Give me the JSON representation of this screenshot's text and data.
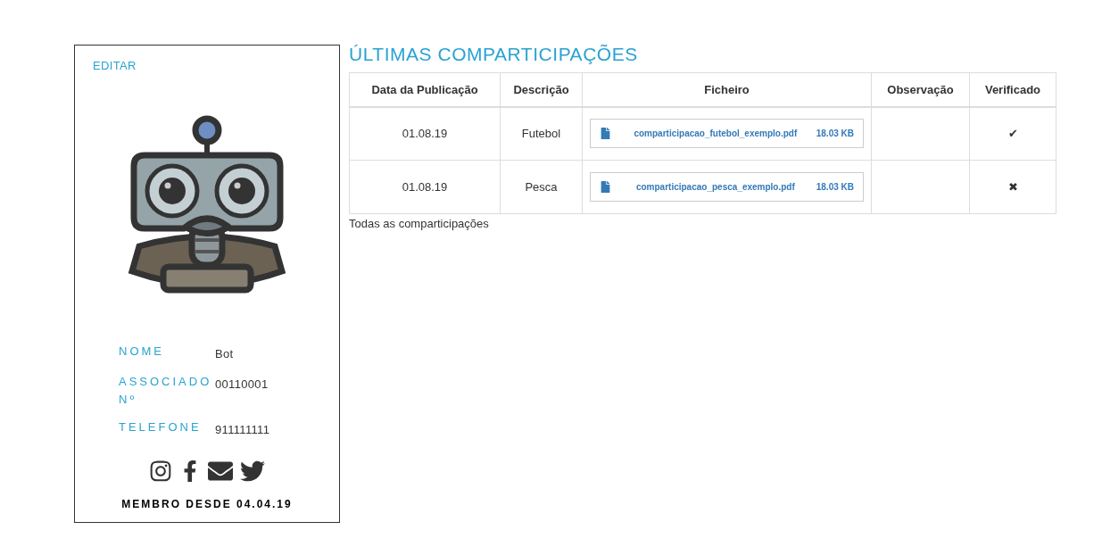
{
  "profile": {
    "edit_link": "EDITAR",
    "fields": [
      {
        "label": "NOME",
        "value": "Bot"
      },
      {
        "label": "ASSOCIADO Nº",
        "value": "00110001"
      },
      {
        "label": "TELEFONE",
        "value": "911111111"
      }
    ],
    "member_since": "MEMBRO DESDE 04.04.19"
  },
  "section_title": "ÚLTIMAS COMPARTICIPAÇÕES",
  "table": {
    "columns": [
      "Data da Publicação",
      "Descrição",
      "Ficheiro",
      "Observação",
      "Verificado"
    ],
    "rows": [
      {
        "date": "01.08.19",
        "description": "Futebol",
        "file_name": "comparticipacao_futebol_exemplo.pdf",
        "file_size": "18.03 KB",
        "verified": "✔"
      },
      {
        "date": "01.08.19",
        "description": "Pesca",
        "file_name": "comparticipacao_pesca_exemplo.pdf",
        "file_size": "18.03 KB",
        "verified": "✖"
      }
    ]
  },
  "all_link": "Todas as comparticipações"
}
